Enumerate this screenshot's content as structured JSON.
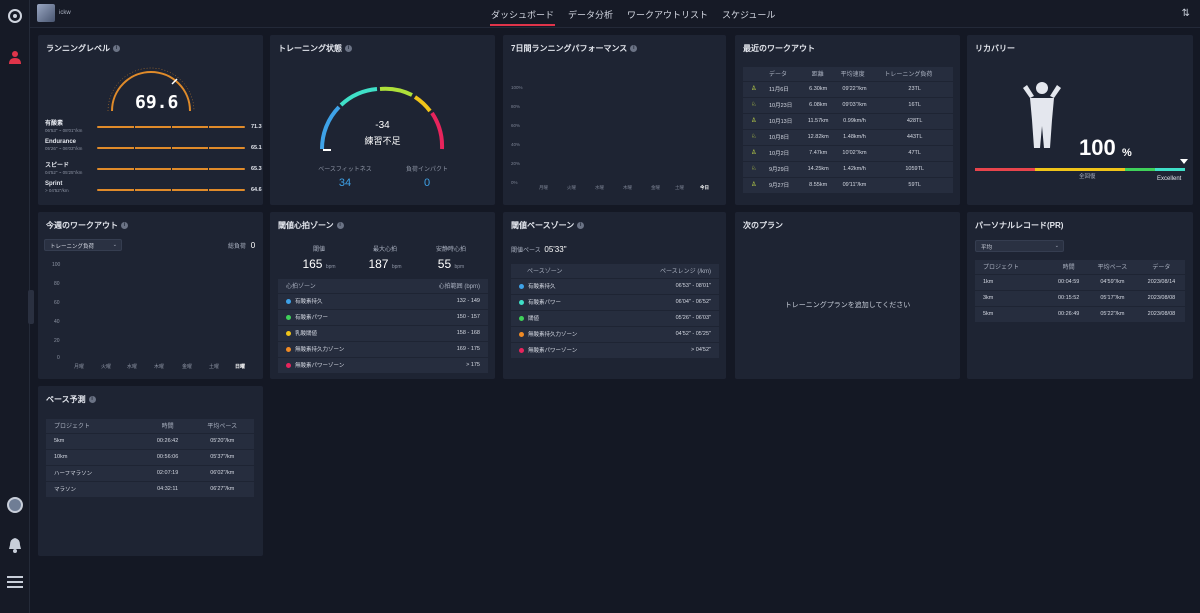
{
  "user": {
    "name": "ickw"
  },
  "nav": {
    "tabs": [
      "ダッシュボード",
      "データ分析",
      "ワークアウトリスト",
      "スケジュール"
    ],
    "active": 0
  },
  "colors": {
    "accent": "#e0344a",
    "blue": "#3ea2e8",
    "orange": "#e08b2a",
    "card": "#1e2433"
  },
  "running_level": {
    "title": "ランニングレベル",
    "value": "69.6",
    "rows": [
      {
        "name": "有酸素",
        "pace": "06'53\" ~ 08'01\"/km",
        "value": "71.3"
      },
      {
        "name": "Endurance",
        "pace": "05'26\" ~ 06'03\"/km",
        "value": "65.1"
      },
      {
        "name": "スピード",
        "pace": "04'52\" ~ 05'25\"/km",
        "value": "65.3"
      },
      {
        "name": "Sprint",
        "pace": "> 04'52\"/km",
        "value": "64.6"
      }
    ]
  },
  "training_status": {
    "title": "トレーニング状態",
    "value": "-34",
    "status": "練習不足",
    "fitness_label": "ベースフィットネス",
    "fitness_value": "34",
    "impact_label": "負荷インパクト",
    "impact_value": "0"
  },
  "performance": {
    "title": "7日間ランニングパフォーマンス",
    "y_ticks": [
      "100%",
      "80%",
      "60%",
      "40%",
      "20%",
      "0%"
    ],
    "days": [
      "月曜",
      "火曜",
      "水曜",
      "木曜",
      "金曜",
      "土曜",
      "今日"
    ]
  },
  "recent_workouts": {
    "title": "最近のワークアウト",
    "headers": [
      "データ",
      "距離",
      "平均速度",
      "トレーニング負荷"
    ],
    "rows": [
      [
        "11月6日",
        "6.30km",
        "09'22\"/km",
        "23TL"
      ],
      [
        "10月23日",
        "6.08km",
        "09'03\"/km",
        "16TL"
      ],
      [
        "10月13日",
        "11.57km",
        "0.99km/h",
        "428TL"
      ],
      [
        "10月8日",
        "12.82km",
        "1.48km/h",
        "443TL"
      ],
      [
        "10月2日",
        "7.47km",
        "10'02\"/km",
        "47TL"
      ],
      [
        "9月29日",
        "14.25km",
        "1.42km/h",
        "1059TL"
      ],
      [
        "9月27日",
        "8.55km",
        "09'11\"/km",
        "59TL"
      ]
    ]
  },
  "recovery": {
    "title": "リカバリー",
    "value": "100",
    "unit": "%",
    "sub": "全回復",
    "rating": "Excellent",
    "level": 1.0
  },
  "weekly": {
    "title": "今週のワークアウト",
    "dropdown": "トレーニング負荷",
    "total_label": "総負荷",
    "total_value": "0",
    "y_ticks": [
      "100",
      "80",
      "60",
      "40",
      "20",
      "0"
    ],
    "days": [
      "月曜",
      "火曜",
      "水曜",
      "木曜",
      "金曜",
      "土曜",
      "日曜"
    ]
  },
  "hr_zones": {
    "title": "閾値心拍ゾーン",
    "threshold_label": "閾値",
    "threshold_value": "165",
    "unit": "bpm",
    "max_label": "最大心拍",
    "max_value": "187",
    "rest_label": "安静時心拍",
    "rest_value": "55",
    "headers": [
      "心拍ゾーン",
      "心拍範囲 (bpm)"
    ],
    "rows": [
      {
        "name": "有酸素持久",
        "range": "132 - 149",
        "color": "#3ea2e8"
      },
      {
        "name": "有酸素パワー",
        "range": "150 - 157",
        "color": "#3fd15a"
      },
      {
        "name": "乳酸閾値",
        "range": "158 - 168",
        "color": "#f0c419"
      },
      {
        "name": "無酸素持久力ゾーン",
        "range": "169 - 175",
        "color": "#f08a24"
      },
      {
        "name": "無酸素パワーゾーン",
        "range": "> 175",
        "color": "#e8245c"
      }
    ]
  },
  "pace_zones": {
    "title": "閾値ペースゾーン",
    "threshold_label": "閾値ペース",
    "threshold_value": "05'33\"",
    "headers": [
      "ペースゾーン",
      "ペースレンジ (/km)"
    ],
    "rows": [
      {
        "name": "有酸素持久",
        "range": "06'53\" - 08'01\"",
        "color": "#3ea2e8"
      },
      {
        "name": "有酸素パワー",
        "range": "06'04\" - 06'52\"",
        "color": "#3fe0c8"
      },
      {
        "name": "閾値",
        "range": "05'26\" - 06'03\"",
        "color": "#3fd15a"
      },
      {
        "name": "無酸素持久力ゾーン",
        "range": "04'52\" - 05'25\"",
        "color": "#f08a24"
      },
      {
        "name": "無酸素パワーゾーン",
        "range": "> 04'52\"",
        "color": "#e8245c"
      }
    ]
  },
  "next_plan": {
    "title": "次のプラン",
    "empty": "トレーニングプランを追加してください"
  },
  "pr": {
    "title": "パーソナルレコード(PR)",
    "dropdown": "平均",
    "headers": [
      "プロジェクト",
      "時間",
      "平均ペース",
      "データ"
    ],
    "rows": [
      [
        "1km",
        "00:04:59",
        "04'59\"/km",
        "2023/08/14"
      ],
      [
        "3km",
        "00:15:52",
        "05'17\"/km",
        "2023/08/08"
      ],
      [
        "5km",
        "00:26:49",
        "05'22\"/km",
        "2023/08/08"
      ]
    ]
  },
  "pace_pred": {
    "title": "ペース予測",
    "headers": [
      "プロジェクト",
      "時間",
      "平均ペース"
    ],
    "rows": [
      [
        "5km",
        "00:26:42",
        "05'20\"/km"
      ],
      [
        "10km",
        "00:56:06",
        "05'37\"/km"
      ],
      [
        "ハーフマラソン",
        "02:07:19",
        "06'02\"/km"
      ],
      [
        "マラソン",
        "04:32:11",
        "06'27\"/km"
      ]
    ]
  }
}
